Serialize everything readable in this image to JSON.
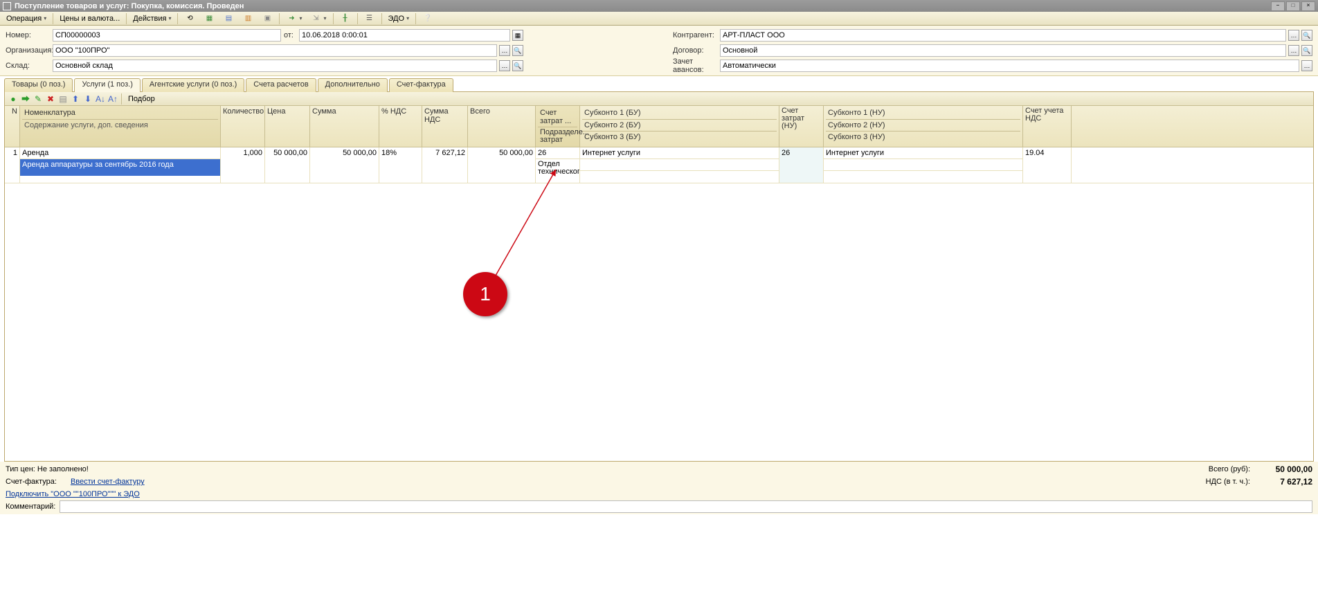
{
  "window_title": "Поступление товаров и услуг: Покупка, комиссия. Проведен",
  "toolbar": {
    "operation": "Операция",
    "prices": "Цены и валюта...",
    "actions": "Действия",
    "edo": "ЭДО"
  },
  "form": {
    "number_label": "Номер:",
    "number": "СП00000003",
    "from_label": "от:",
    "date": "10.06.2018 0:00:01",
    "org_label": "Организация:",
    "org": "ООО \"100ПРО\"",
    "warehouse_label": "Склад:",
    "warehouse": "Основной склад",
    "counterparty_label": "Контрагент:",
    "counterparty": "АРТ-ПЛАСТ ООО",
    "contract_label": "Договор:",
    "contract": "Основной",
    "advances_label": "Зачет авансов:",
    "advances": "Автоматически"
  },
  "tabs": {
    "goods": "Товары (0 поз.)",
    "services": "Услуги (1 поз.)",
    "agent": "Агентские услуги (0 поз.)",
    "accounts": "Счета расчетов",
    "additional": "Дополнительно",
    "invoice": "Счет-фактура"
  },
  "grid_toolbar": {
    "selection": "Подбор"
  },
  "grid_headers": {
    "n": "N",
    "nomen": "Номенклатура",
    "nomen_sub": "Содержание услуги, доп. сведения",
    "qty": "Количество",
    "price": "Цена",
    "sum": "Сумма",
    "vat": "% НДС",
    "vat_sum": "Сумма НДС",
    "total": "Всего",
    "cost_account": "Счет затрат ...",
    "cost_dept": "Подразделе... затрат",
    "sub1": "Субконто 1 (БУ)",
    "sub2": "Субконто 2 (БУ)",
    "sub3": "Субконто 3 (БУ)",
    "costn": "Счет затрат (НУ)",
    "subn1": "Субконто 1 (НУ)",
    "subn2": "Субконто 2 (НУ)",
    "subn3": "Субконто 3 (НУ)",
    "vat_acct": "Счет учета НДС"
  },
  "row": {
    "n": "1",
    "nomen": "Аренда",
    "nomen_sub": "Аренда аппаратуры за сентябрь 2016 года",
    "qty": "1,000",
    "price": "50 000,00",
    "sum": "50 000,00",
    "vat": "18%",
    "vat_sum": "7 627,12",
    "total": "50 000,00",
    "cost_account": "26",
    "cost_dept": "Отдел технического",
    "sub1": "Интернет услуги",
    "sub2": "",
    "sub3": "",
    "costn": "26",
    "subn1": "Интернет услуги",
    "subn2": "",
    "subn3": "",
    "vat_acct": "19.04"
  },
  "footer": {
    "price_type": "Тип цен: Не заполнено!",
    "invoice_label": "Счет-фактура:",
    "invoice_link": "Ввести счет-фактуру",
    "edo_link": "Подключить \"ООО \"\"100ПРО\"\"\" к ЭДО",
    "comment_label": "Комментарий:",
    "total_label": "Всего (руб):",
    "total": "50 000,00",
    "vat_label": "НДС (в т. ч.):",
    "vat": "7 627,12"
  },
  "annotation": "1"
}
